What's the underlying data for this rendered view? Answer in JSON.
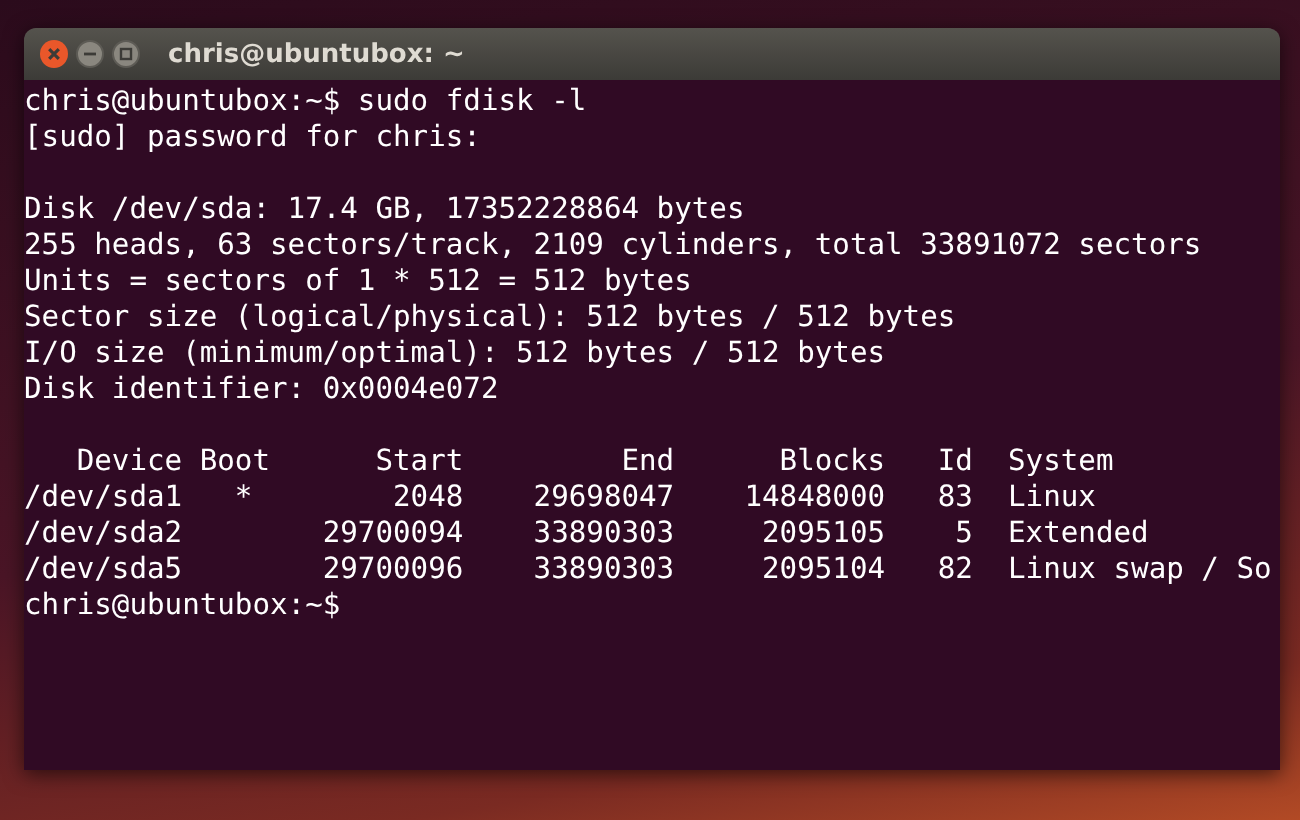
{
  "window": {
    "title": "chris@ubuntubox: ~"
  },
  "terminal": {
    "blocks": [
      [
        "chris@ubuntubox:~$ sudo fdisk -l",
        "[sudo] password for chris:"
      ],
      [
        "Disk /dev/sda: 17.4 GB, 17352228864 bytes",
        "255 heads, 63 sectors/track, 2109 cylinders, total 33891072 sectors",
        "Units = sectors of 1 * 512 = 512 bytes",
        "Sector size (logical/physical): 512 bytes / 512 bytes",
        "I/O size (minimum/optimal): 512 bytes / 512 bytes",
        "Disk identifier: 0x0004e072"
      ],
      [
        "   Device Boot      Start         End      Blocks   Id  System",
        "/dev/sda1   *        2048    29698047    14848000   83  Linux",
        "/dev/sda2        29700094    33890303     2095105    5  Extended",
        "/dev/sda5        29700096    33890303     2095104   82  Linux swap / So",
        "chris@ubuntubox:~$"
      ]
    ]
  }
}
